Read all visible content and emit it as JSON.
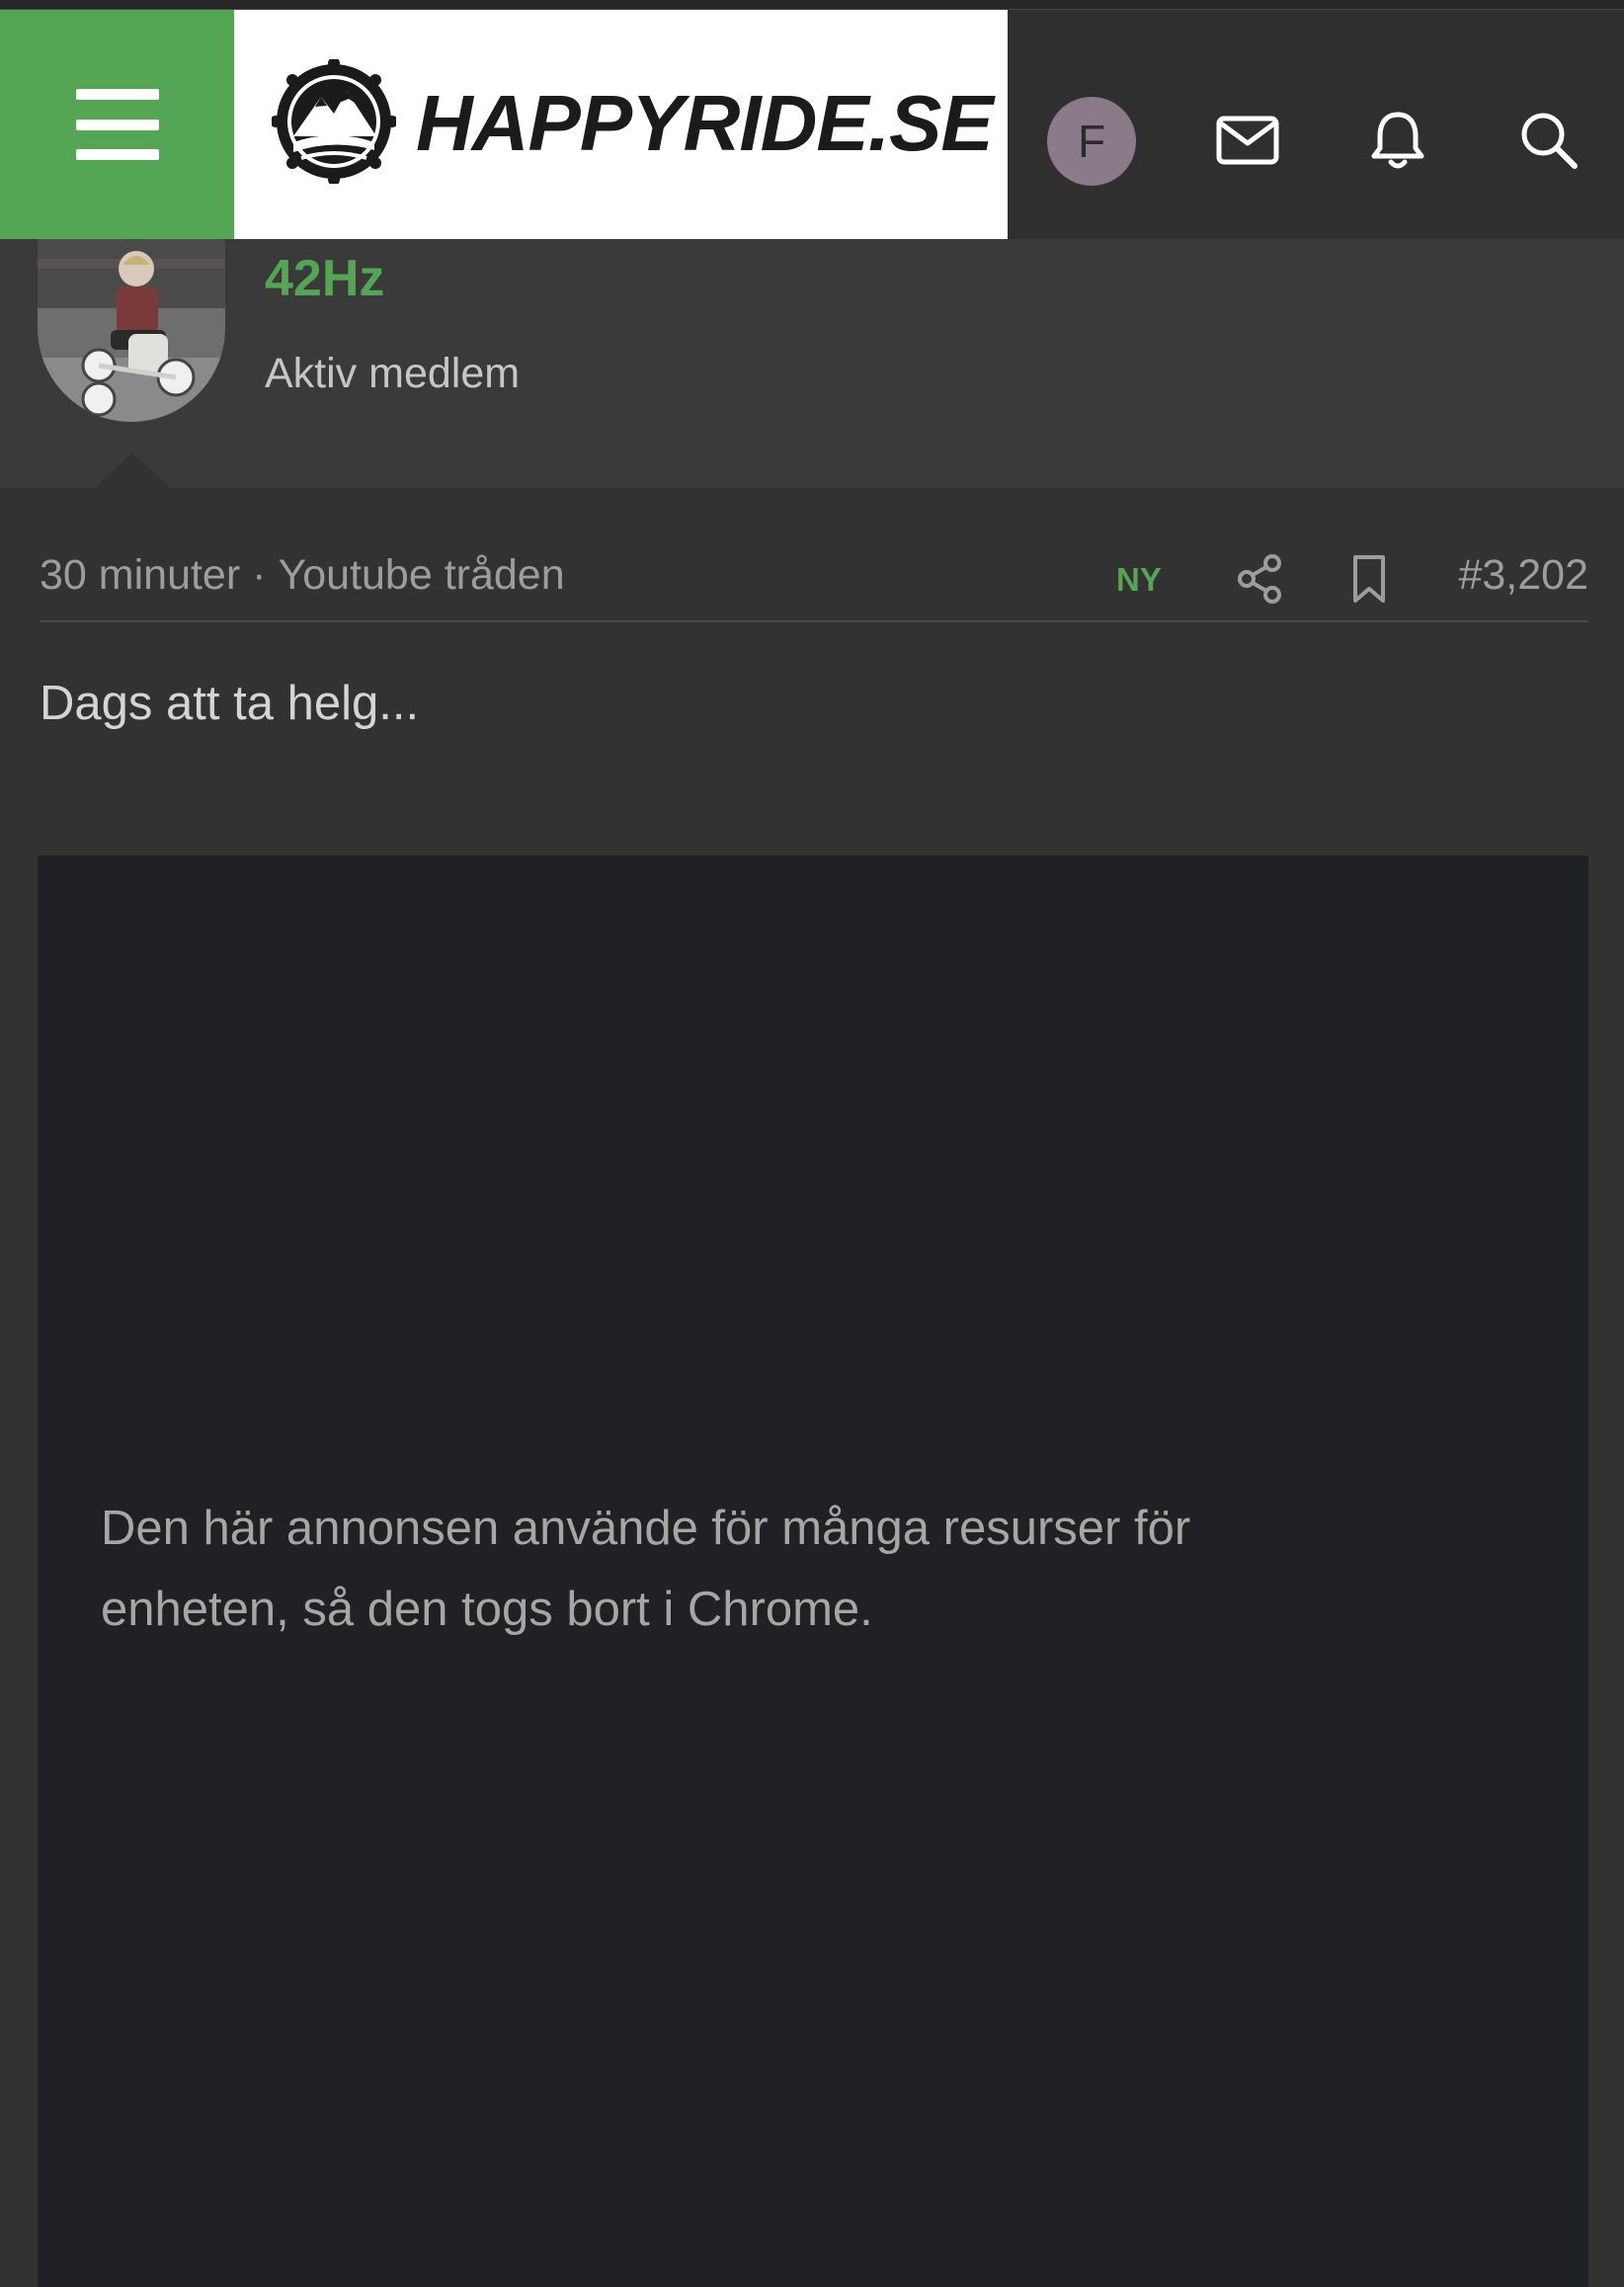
{
  "header": {
    "logo_text": "HAPPYRIDE.SE",
    "account_initial": "F",
    "icons": [
      "menu-icon",
      "mail-icon",
      "bell-icon",
      "search-icon"
    ],
    "colors": {
      "brand": "#54a554",
      "header_bg": "#2f2f2f",
      "account": "#8a7a8a"
    }
  },
  "user": {
    "name": "42Hz",
    "title": "Aktiv medlem"
  },
  "post": {
    "time": "30 minuter",
    "separator": "·",
    "thread": "Youtube tråden",
    "badge": "NY",
    "number": "#3,202",
    "body": "Dags att ta helg..."
  },
  "ad": {
    "message": "Den här annonsen använde för många resurser för enheten, så den togs bort i Chrome."
  }
}
